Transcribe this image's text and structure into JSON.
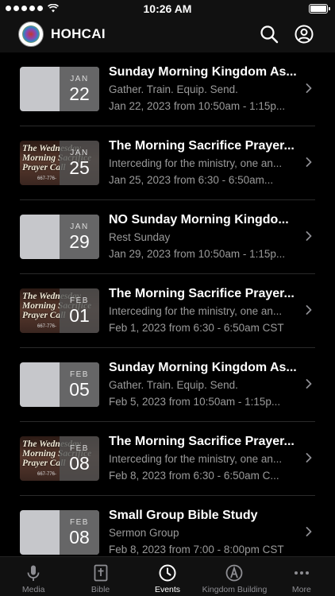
{
  "status_bar": {
    "time": "10:26 AM"
  },
  "header": {
    "title": "HOHCAI"
  },
  "events": [
    {
      "title": "Sunday Morning Kingdom As...",
      "subtitle": "Gather. Train. Equip. Send.",
      "time": "Jan 22, 2023 from 10:50am - 1:15p...",
      "month": "JAN",
      "day": "22",
      "thumb": "plain"
    },
    {
      "title": "The Morning Sacrifice Prayer...",
      "subtitle": "Interceding for the ministry, one an...",
      "time": "Jan 25, 2023 from 6:30 - 6:50am...",
      "month": "JAN",
      "day": "25",
      "thumb": "prayer"
    },
    {
      "title": "NO Sunday Morning Kingdo...",
      "subtitle": "Rest Sunday",
      "time": "Jan 29, 2023 from 10:50am - 1:15p...",
      "month": "JAN",
      "day": "29",
      "thumb": "plain"
    },
    {
      "title": "The Morning Sacrifice Prayer...",
      "subtitle": "Interceding for the ministry, one an...",
      "time": "Feb 1, 2023 from 6:30 - 6:50am CST",
      "month": "FEB",
      "day": "01",
      "thumb": "prayer"
    },
    {
      "title": "Sunday Morning Kingdom As...",
      "subtitle": "Gather. Train. Equip. Send.",
      "time": "Feb 5, 2023 from 10:50am - 1:15p...",
      "month": "FEB",
      "day": "05",
      "thumb": "plain"
    },
    {
      "title": "The Morning Sacrifice Prayer...",
      "subtitle": "Interceding for the ministry, one an...",
      "time": "Feb 8, 2023 from 6:30 - 6:50am C...",
      "month": "FEB",
      "day": "08",
      "thumb": "prayer"
    },
    {
      "title": "Small Group Bible Study",
      "subtitle": "Sermon Group",
      "time": "Feb 8, 2023 from 7:00 - 8:00pm CST",
      "month": "FEB",
      "day": "08",
      "thumb": "plain"
    }
  ],
  "prayer_thumb": {
    "text": "The Wednesday\nMorning Sacrifice\nPrayer Call",
    "phone": "667-776-"
  },
  "tabs": [
    {
      "label": "Media",
      "icon": "microphone-icon",
      "active": false
    },
    {
      "label": "Bible",
      "icon": "bible-icon",
      "active": false
    },
    {
      "label": "Events",
      "icon": "clock-icon",
      "active": true
    },
    {
      "label": "Kingdom Building",
      "icon": "kingdom-building-icon",
      "active": false
    },
    {
      "label": "More",
      "icon": "more-icon",
      "active": false
    }
  ],
  "colors": {
    "background": "#000000",
    "bar": "#111111",
    "badge": "#505050",
    "secondary_text": "#9a9a9a"
  }
}
